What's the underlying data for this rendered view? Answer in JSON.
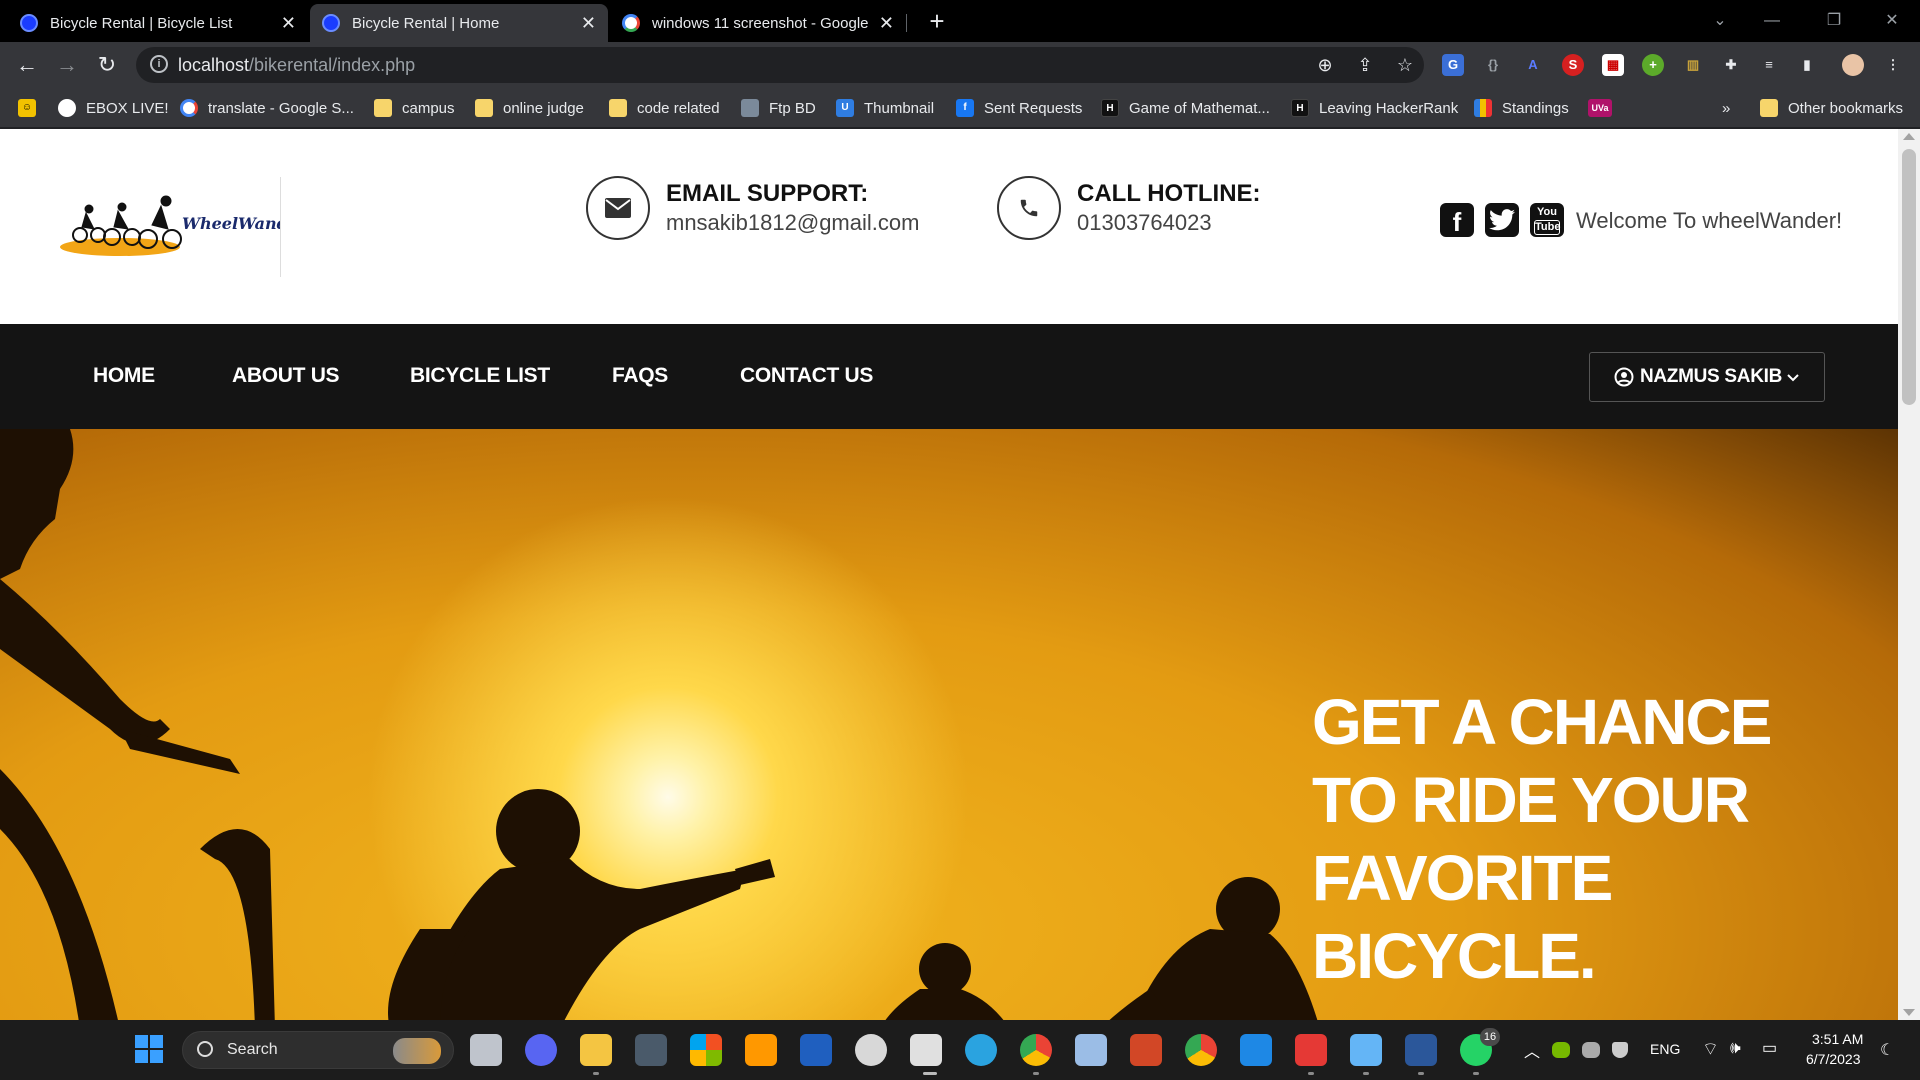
{
  "browser": {
    "tabs": [
      {
        "title": "Bicycle Rental | Bicycle List",
        "active": false
      },
      {
        "title": "Bicycle Rental | Home",
        "active": true
      },
      {
        "title": "windows 11 screenshot - Google",
        "active": false
      }
    ],
    "url_host": "localhost",
    "url_path": "/bikerental/index.php",
    "bookmarks": [
      "EBOX LIVE!",
      "translate - Google S...",
      "campus",
      "online judge",
      "code related",
      "Ftp BD",
      "Thumbnail",
      "Sent Requests",
      "Game of Mathemat...",
      "Leaving HackerRank",
      "Standings",
      "UVa"
    ],
    "bookmarks_overflow": "»",
    "other_bookmarks": "Other bookmarks"
  },
  "site": {
    "logo_text": "WheelWander",
    "email": {
      "label": "EMAIL SUPPORT:",
      "value": "mnsakib1812@gmail.com"
    },
    "hotline": {
      "label": "CALL HOTLINE:",
      "value": "01303764023"
    },
    "social_icons": [
      "facebook-icon",
      "twitter-icon",
      "youtube-icon"
    ],
    "youtube_text_top": "You",
    "youtube_text_bottom": "Tube",
    "welcome": "Welcome To wheelWander!",
    "nav": [
      "HOME",
      "ABOUT US",
      "BICYCLE LIST",
      "FAQS",
      "CONTACT US"
    ],
    "user": "NAZMUS SAKIB",
    "hero_title": "GET A CHANCE TO RIDE YOUR FAVORITE BICYCLE."
  },
  "taskbar": {
    "search_label": "Search",
    "whatsapp_badge": "16",
    "language": "ENG",
    "time": "3:51 AM",
    "date": "6/7/2023"
  },
  "colors": {
    "navbar_bg": "#141414",
    "hero_orange": "#e39b12",
    "browser_dark": "#35363a"
  }
}
